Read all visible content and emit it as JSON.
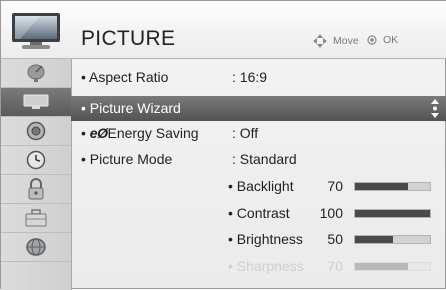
{
  "header": {
    "title": "PICTURE",
    "hint_move": "Move",
    "hint_ok": "OK"
  },
  "sidebar": {
    "items": [
      {
        "icon": "satellite-dish-icon"
      },
      {
        "icon": "tv-screen-icon",
        "active": true
      },
      {
        "icon": "speaker-icon"
      },
      {
        "icon": "clock-icon"
      },
      {
        "icon": "lock-icon"
      },
      {
        "icon": "briefcase-icon"
      },
      {
        "icon": "globe-icon"
      }
    ]
  },
  "menu": {
    "aspect_ratio": {
      "label": "• Aspect Ratio",
      "value": ": 16:9"
    },
    "picture_wizard": {
      "label": "• Picture Wizard"
    },
    "energy_saving": {
      "bullet": "• ",
      "logo": "eØ",
      "label": "Energy Saving",
      "value": ": Off"
    },
    "picture_mode": {
      "label": "• Picture Mode",
      "value": ": Standard"
    },
    "backlight": {
      "label": "• Backlight",
      "value": "70",
      "level": 70
    },
    "contrast": {
      "label": "• Contrast",
      "value": "100",
      "level": 100
    },
    "brightness": {
      "label": "• Brightness",
      "value": "50",
      "level": 50
    },
    "sharpness": {
      "label": "• Sharpness",
      "value": "70",
      "level": 70
    }
  },
  "colors": {
    "selected_bg": "#636363",
    "bar_fill": "#4a4a4a",
    "bar_track": "#d2d2d2"
  }
}
